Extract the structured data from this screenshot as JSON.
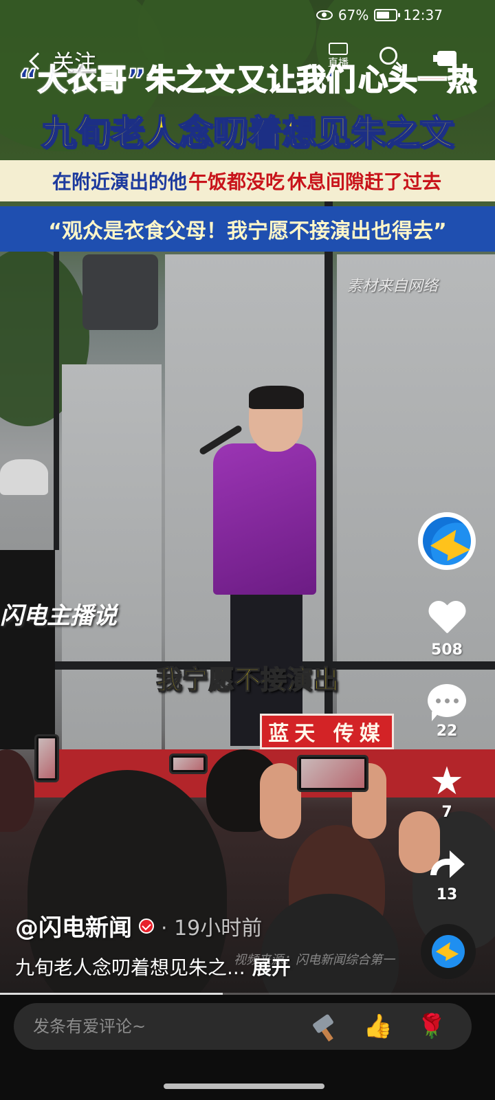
{
  "status_bar": {
    "battery_text": "67%",
    "battery_level": 0.67,
    "time": "12:37"
  },
  "top_nav": {
    "follow_label": "关注",
    "live_label": "直播"
  },
  "video": {
    "headline_1": {
      "part_a": "“大衣哥”",
      "part_b": "朱之文",
      "part_c": "又让我们",
      "part_d": "心头一热"
    },
    "headline_2": "九旬老人念叨着想见朱之文",
    "headline_3": {
      "part_a": "在附近演出的他",
      "part_b": "午饭都没吃",
      "part_c": "休息间隙赶了过去"
    },
    "headline_4": "“观众是衣食父母！我宁愿不接演出也得去”",
    "source_note": "素材来自网络",
    "watermark_logo": "闪电主播说",
    "subtitle": "我宁愿不接演出",
    "stage_sign": "蓝天  传媒",
    "video_credit": "视频来源：闪电新闻综合第一"
  },
  "actions": {
    "likes": "508",
    "comments": "22",
    "favorites": "7",
    "shares": "13"
  },
  "post": {
    "author": "@闪电新闻",
    "time_ago": "· 19小时前",
    "caption": "九旬老人念叨着想见朱之...",
    "expand_label": "展开",
    "progress": 0.45
  },
  "comment_bar": {
    "placeholder": "发条有爱评论~",
    "icons": [
      "hammer-icon",
      "thumbs-up-icon",
      "rose-icon"
    ]
  },
  "colors": {
    "banner_blue": "#1f4fb0",
    "headline_red": "#c8141b",
    "headline_yellow": "#ffe21c",
    "jacket_purple": "#8a2aa3",
    "brand_blue": "#1f8ff0",
    "brand_yellow": "#ffc21b"
  }
}
